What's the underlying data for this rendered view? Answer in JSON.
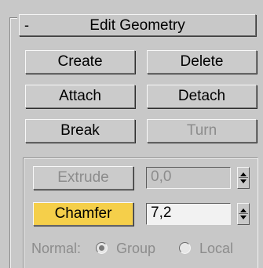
{
  "panel": {
    "title": "Edit Geometry",
    "collapse_symbol": "-"
  },
  "buttons": {
    "create": "Create",
    "delete": "Delete",
    "attach": "Attach",
    "detach": "Detach",
    "break": "Break",
    "turn": "Turn"
  },
  "extrude": {
    "label": "Extrude",
    "value": "0,0",
    "state": "disabled"
  },
  "chamfer": {
    "label": "Chamfer",
    "value": "7,2",
    "state": "active"
  },
  "normal": {
    "label": "Normal:",
    "options": [
      "Group",
      "Local"
    ],
    "selected": "Group"
  },
  "colors": {
    "panel_bg": "#c8c8c8",
    "active_button": "#f5cf4a",
    "disabled_text": "#8c8c8c"
  }
}
